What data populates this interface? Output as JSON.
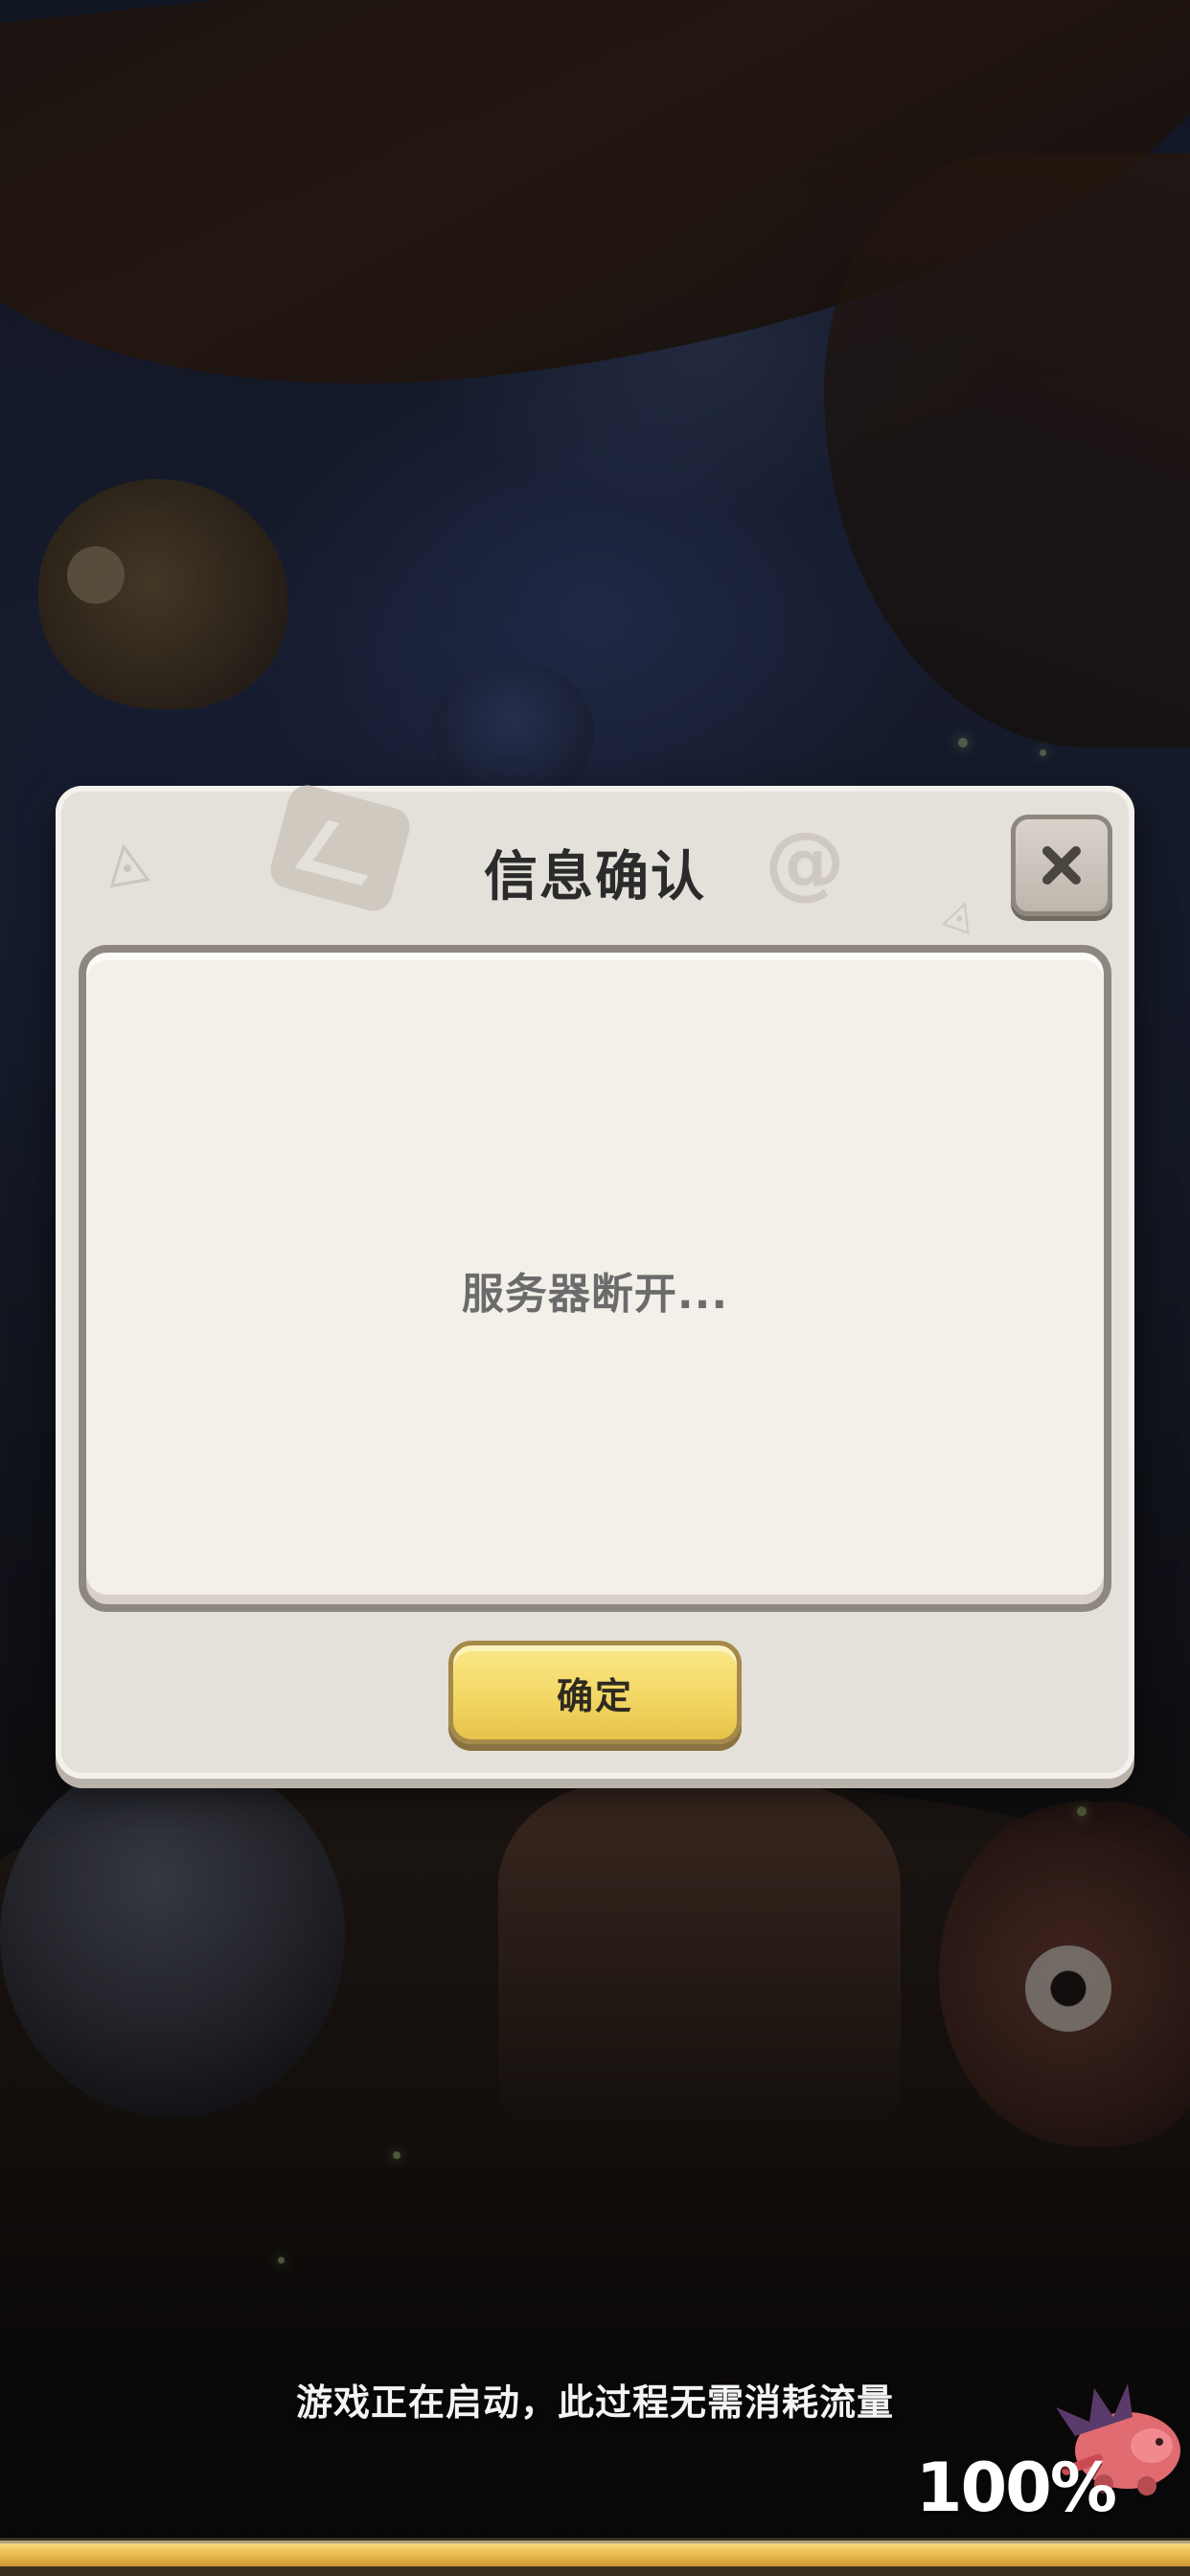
{
  "dialog": {
    "title": "信息确认",
    "message": "服务器断开...",
    "confirm_label": "确定",
    "close_icon": "close-icon"
  },
  "loading": {
    "hint": "游戏正在启动，此过程无需消耗流量",
    "percent_text": "100%",
    "progress": 1.0
  },
  "colors": {
    "confirm_button": "#f3d764",
    "dialog_background": "#e4e0da",
    "progress_fill": "#e7b84a"
  }
}
